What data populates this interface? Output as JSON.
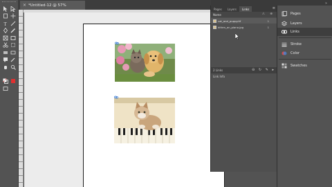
{
  "document": {
    "tab_close": "×",
    "tab_title": "*Untitled-12 @ 57%"
  },
  "tools": {
    "icons": [
      "selection-tool-icon",
      "direct-selection-tool-icon",
      "page-tool-icon",
      "gap-tool-icon",
      "type-tool-icon",
      "line-tool-icon",
      "pen-tool-icon",
      "pencil-tool-icon",
      "rectangle-frame-tool-icon",
      "rectangle-tool-icon",
      "scissors-tool-icon",
      "free-transform-tool-icon",
      "gradient-swatch-tool-icon",
      "gradient-feather-tool-icon",
      "note-tool-icon",
      "eyedropper-tool-icon",
      "hand-tool-icon",
      "zoom-tool-icon",
      "fill-stroke-icon",
      "apply-color-icon",
      "screen-mode-icon"
    ]
  },
  "links_panel": {
    "tabs": [
      "Pages",
      "Layers",
      "Links"
    ],
    "active_tab": "Links",
    "menu_icon": "≡",
    "header_label": "Name",
    "header_icons": "⚠ ⊕",
    "rows": [
      {
        "name": "cat_and_puppy.tif",
        "page": "1"
      },
      {
        "name": "kitten_on_piano.jpg",
        "page": "1"
      }
    ],
    "info_label": "2 Links",
    "info_icons": "⊖ ↻ ✎ ▸",
    "link_info_label": "Link Info"
  },
  "dock": {
    "items": [
      {
        "label": "Pages",
        "icon": "pages-icon"
      },
      {
        "label": "Layers",
        "icon": "layers-icon"
      },
      {
        "label": "Links",
        "icon": "links-icon"
      },
      {
        "label": "Stroke",
        "icon": "stroke-icon"
      },
      {
        "label": "Color",
        "icon": "color-icon"
      },
      {
        "label": "Swatches",
        "icon": "swatches-icon"
      }
    ],
    "active_item": "Links"
  },
  "colors": {
    "panel_bg": "#535353",
    "pasteboard": "#ececec",
    "page": "#ffffff",
    "accent_red": "#e03030"
  }
}
